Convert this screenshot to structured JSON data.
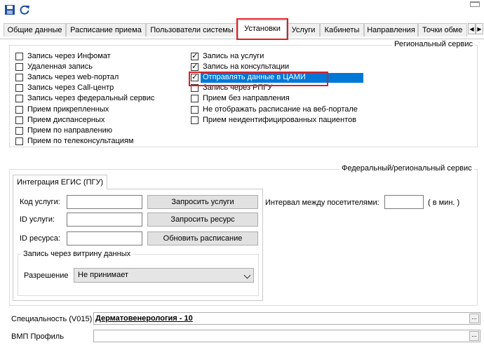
{
  "tabs": [
    {
      "label": "Общие данные"
    },
    {
      "label": "Расписание приема"
    },
    {
      "label": "Пользователи системы"
    },
    {
      "label": "Установки"
    },
    {
      "label": "Услуги"
    },
    {
      "label": "Кабинеты"
    },
    {
      "label": "Направления"
    },
    {
      "label": "Точки обме"
    }
  ],
  "regional": {
    "title": "Региональный сервис",
    "left": [
      {
        "label": "Запись через Инфомат",
        "checked": false
      },
      {
        "label": "Удаленная запись",
        "checked": false
      },
      {
        "label": "Запись через web-портал",
        "checked": false
      },
      {
        "label": "Запись через Call-центр",
        "checked": false
      },
      {
        "label": "Запись через федеральный сервис",
        "checked": false
      },
      {
        "label": "Прием прикрепленных",
        "checked": false
      },
      {
        "label": "Прием диспансерных",
        "checked": false
      },
      {
        "label": "Прием по направлению",
        "checked": false
      },
      {
        "label": "Прием по телеконсультациям",
        "checked": false
      }
    ],
    "right": [
      {
        "label": "Запись на услуги",
        "checked": true
      },
      {
        "label": "Запись на консультации",
        "checked": true
      },
      {
        "label": "Отправлять данные в ЦАМИ",
        "checked": true
      },
      {
        "label": "Запись через РПГУ",
        "checked": false
      },
      {
        "label": "Прием без направления",
        "checked": false
      },
      {
        "label": "Не отображать расписание на веб-портале",
        "checked": false
      },
      {
        "label": "Прием неидентифицированных пациентов",
        "checked": false
      }
    ]
  },
  "federal": {
    "title": "Федеральный/региональный сервис",
    "tab_label": "Интеграция ЕГИС (ПГУ)",
    "service_code_label": "Код услуги:",
    "service_id_label": "ID услуги:",
    "resource_id_label": "ID ресурса:",
    "btn_request_services": "Запросить услуги",
    "btn_request_resource": "Запросить ресурс",
    "btn_update_schedule": "Обновить расписание",
    "interval_label": "Интервал между посетителями:",
    "interval_unit": "( в мин. )",
    "showcase_title": "Запись через витрину данных",
    "permission_label": "Разрешение",
    "permission_value": "Не принимает"
  },
  "bottom": {
    "specialty_label": "Специальность (V015)",
    "specialty_value": "Дерматовенерология - 10",
    "vmp_label": "ВМП Профиль",
    "vmp_value": "",
    "lookup_btn": "..."
  }
}
